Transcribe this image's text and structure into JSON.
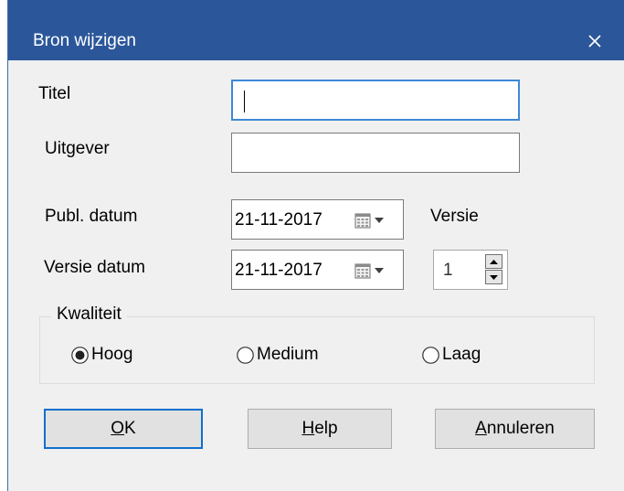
{
  "dialog": {
    "title": "Bron wijzigen",
    "close_glyph": "×"
  },
  "fields": {
    "titel_label": "Titel",
    "titel_value": "",
    "uitgever_label": "Uitgever",
    "uitgever_value": "",
    "publ_datum_label": "Publ. datum",
    "publ_datum_value": "21-11-2017",
    "versie_label": "Versie",
    "versie_datum_label": "Versie datum",
    "versie_datum_value": "21-11-2017",
    "versie_value": "1"
  },
  "kwaliteit": {
    "label": "Kwaliteit",
    "options": [
      "Hoog",
      "Medium",
      "Laag"
    ],
    "selected": "Hoog"
  },
  "buttons": {
    "ok_mnemonic": "O",
    "ok_rest": "K",
    "help_mnemonic": "H",
    "help_rest": "elp",
    "annuleren_mnemonic": "A",
    "annuleren_rest": "nnuleren"
  },
  "icons": {
    "close": "close-icon",
    "calendar": "calendar-icon",
    "dropdown": "chevron-down-icon",
    "spin_up": "spin-up-icon",
    "spin_down": "spin-down-icon"
  },
  "colors": {
    "titlebar": "#2b579a",
    "focus_border": "#3f88d8",
    "default_button_border": "#0f6fcd",
    "dialog_background": "#f0f0f0"
  }
}
